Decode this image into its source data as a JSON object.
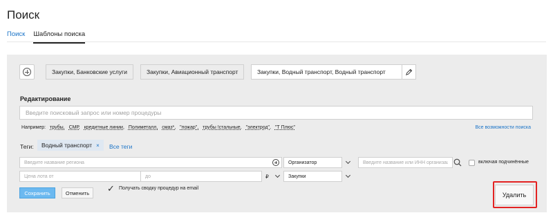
{
  "page": {
    "title": "Поиск"
  },
  "tabs": [
    {
      "label": "Поиск",
      "active": false
    },
    {
      "label": "Шаблоны поиска",
      "active": true
    }
  ],
  "templates": {
    "add_icon": "plus-circle-icon",
    "chips": [
      {
        "label": "Закупки, Банковские услуги",
        "active": false
      },
      {
        "label": "Закупки, Авиационный транспорт",
        "active": false
      },
      {
        "label": "Закупки, Водный транспорт, Водный транспорт",
        "active": true
      }
    ],
    "edit_icon": "pencil-icon"
  },
  "editing": {
    "title": "Редактирование",
    "search_placeholder": "Введите поисковый запрос или номер процедуры",
    "search_value": "",
    "examples_label": "Например:",
    "examples": [
      "трубы,",
      "СМР,",
      "кредитные линии,",
      "Полиметалл,",
      "смаз*,",
      "\"пожар\",",
      "трубы !стальные,",
      "\"электрод\",",
      "\"Т Плюс\""
    ],
    "all_options_link": "Все возможности поиска"
  },
  "tags": {
    "label": "Теги:",
    "items": [
      {
        "label": "Водный транспорт",
        "remove": "×"
      }
    ],
    "all_tags_link": "Все теги"
  },
  "filters": {
    "region_placeholder": "Введите название региона",
    "organizer_select": "Организатор",
    "org_search_placeholder": "Введите название или ИНН организации",
    "include_subordinate_label": "включая подчинённые",
    "include_subordinate_checked": false,
    "price_from_placeholder": "Цена лота от",
    "price_to_placeholder": "до",
    "currency_symbol": "₽",
    "procurement_select": "Закупки"
  },
  "actions": {
    "save_label": "Сохранить",
    "cancel_label": "Отменить",
    "email_checkbox_label": "Получать сводку процедур на email",
    "email_checkbox_checked": true,
    "check_glyph": "✓",
    "delete_label": "Удалить"
  },
  "colors": {
    "link": "#1a73c7",
    "panel_bg": "#ececec",
    "save_button": "#6cb9f0",
    "highlight": "#e32222"
  }
}
